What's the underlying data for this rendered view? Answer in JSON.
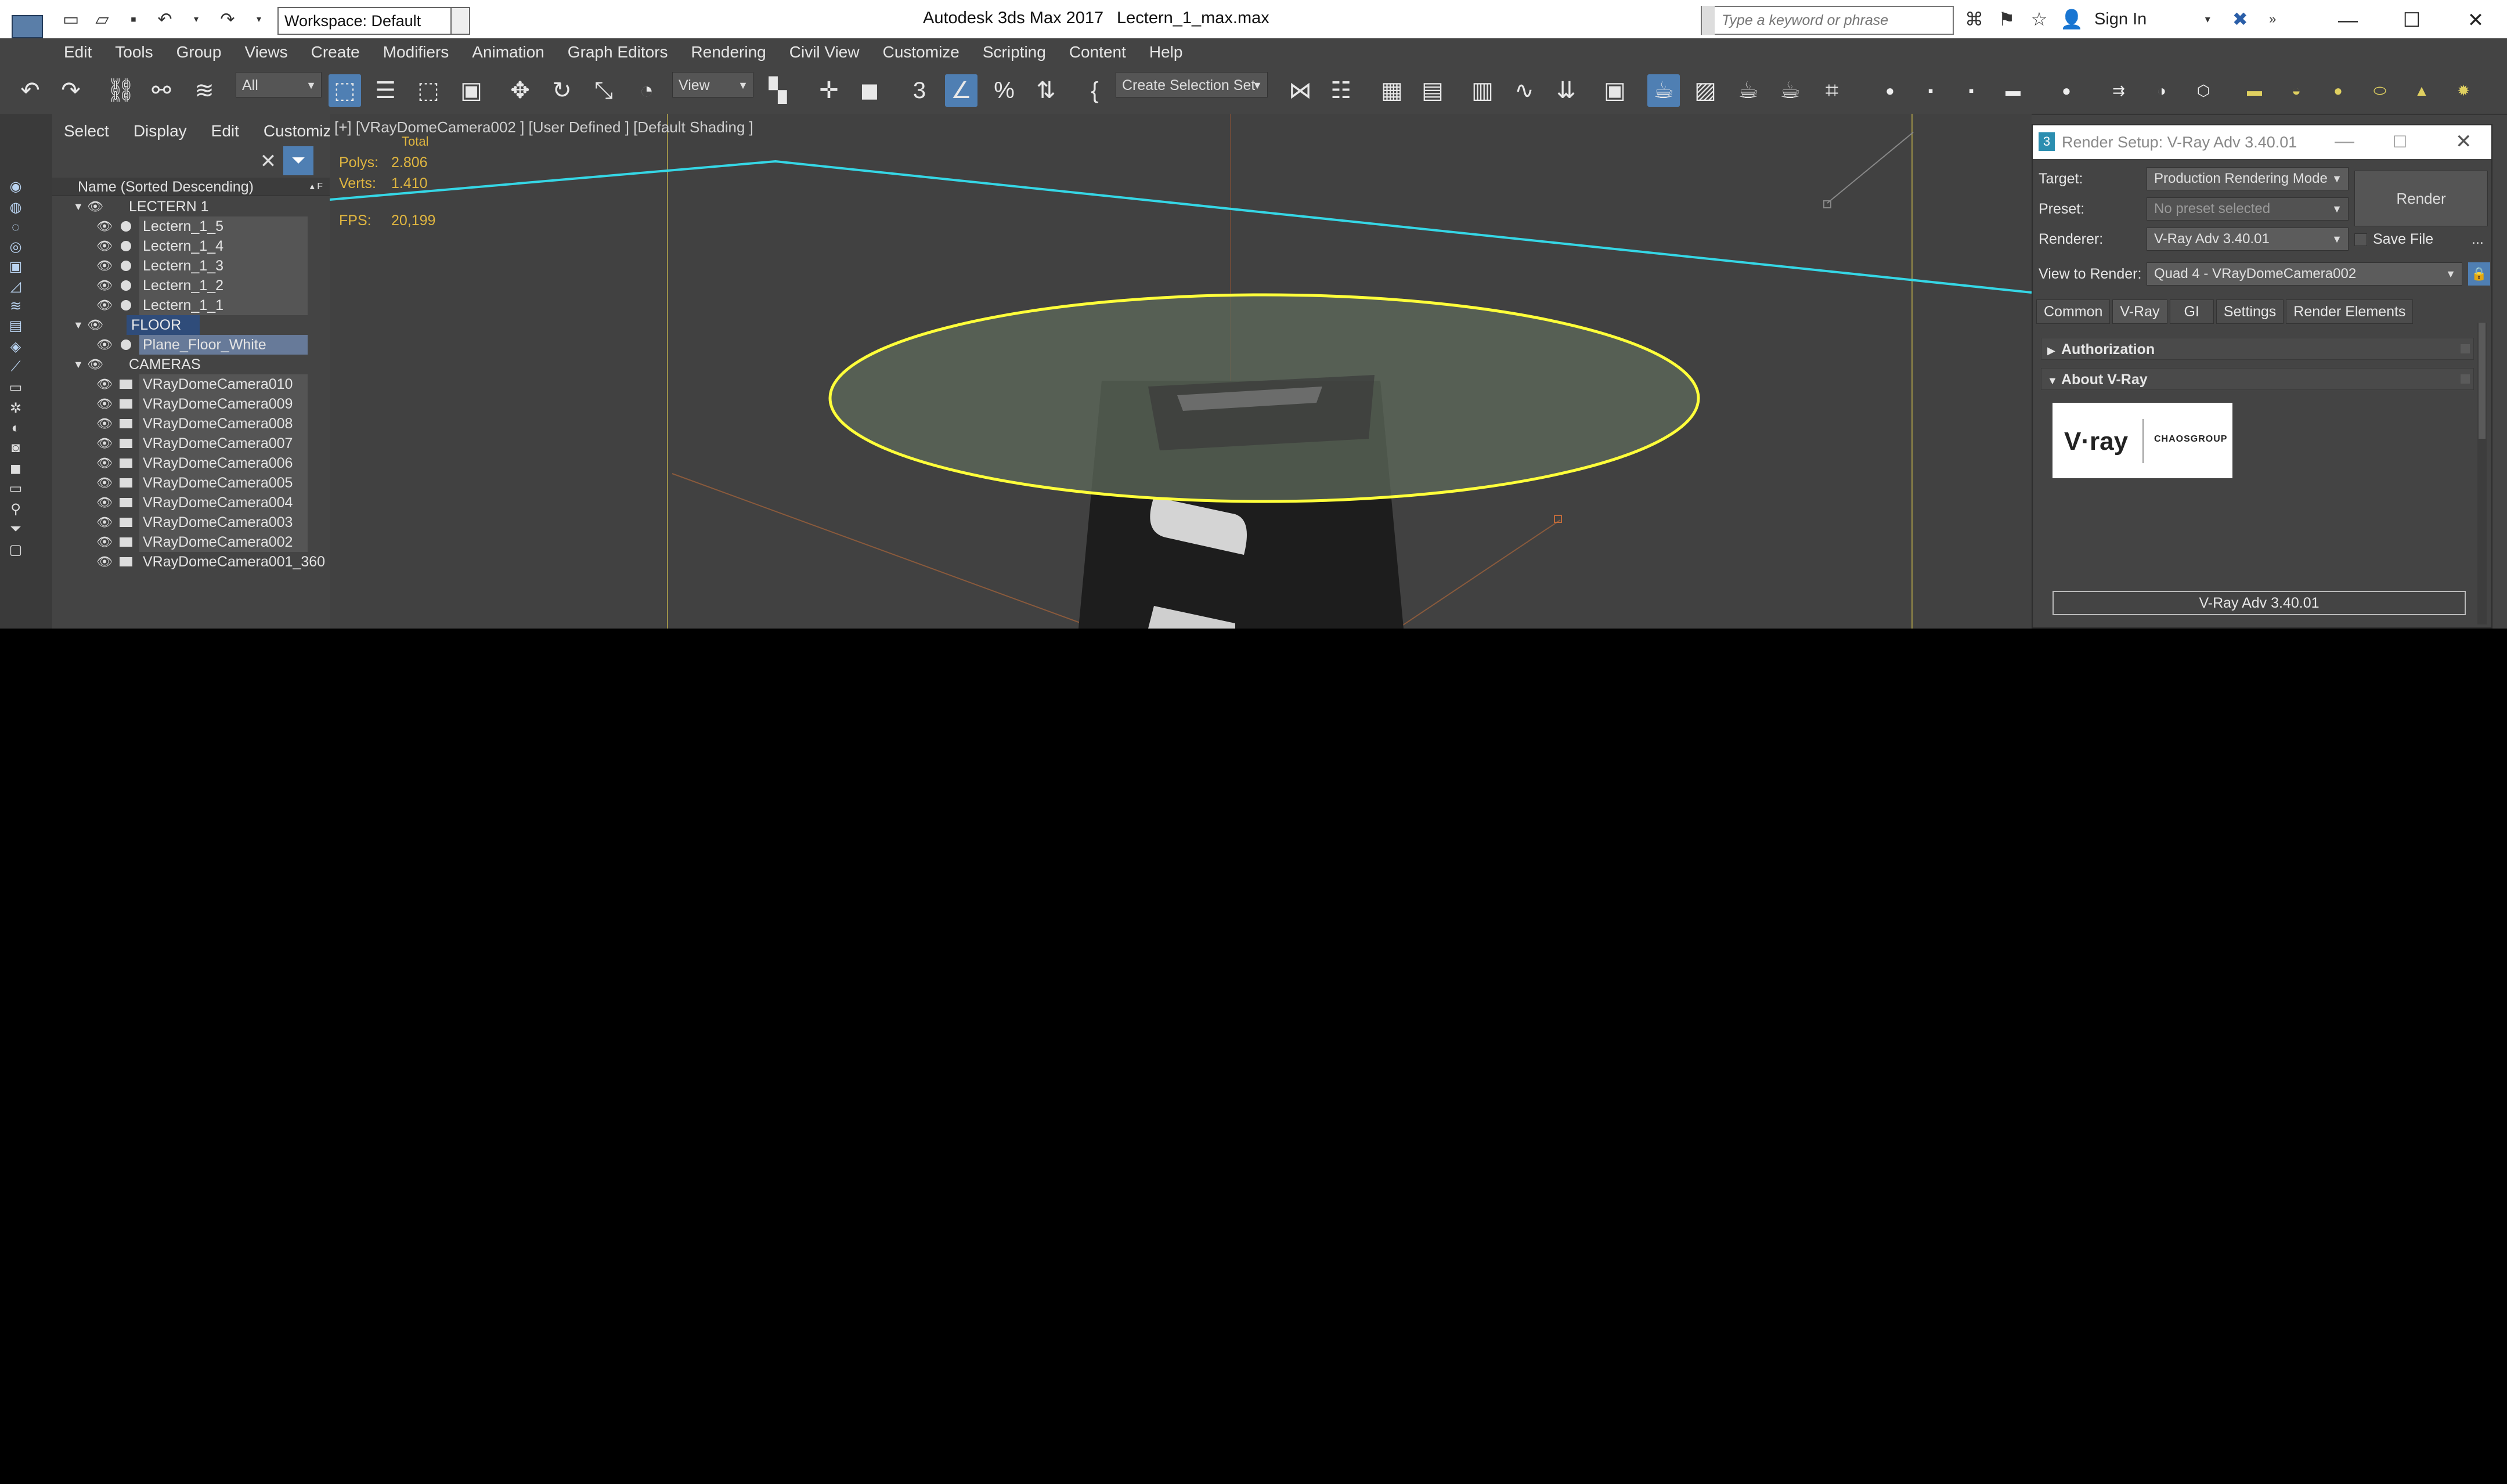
{
  "window": {
    "app_title": "Autodesk 3ds Max 2017",
    "file_name": "Lectern_1_max.max",
    "workspace_label": "Workspace: Default",
    "search_placeholder": "Type a keyword or phrase",
    "sign_in": "Sign In"
  },
  "menu": [
    "Edit",
    "Tools",
    "Group",
    "Views",
    "Create",
    "Modifiers",
    "Animation",
    "Graph Editors",
    "Rendering",
    "Civil View",
    "Customize",
    "Scripting",
    "Content",
    "Help"
  ],
  "toolbar": {
    "filter_value": "All",
    "ref_coord_value": "View",
    "selection_set_value": "Create Selection Set"
  },
  "explorer": {
    "menu": [
      "Select",
      "Display",
      "Edit",
      "Customize"
    ],
    "column_header": "Name (Sorted Descending)",
    "rows": [
      {
        "label": "LECTERN 1",
        "kind": "layer"
      },
      {
        "label": "Lectern_1_5",
        "kind": "object"
      },
      {
        "label": "Lectern_1_4",
        "kind": "object"
      },
      {
        "label": "Lectern_1_3",
        "kind": "object"
      },
      {
        "label": "Lectern_1_2",
        "kind": "object"
      },
      {
        "label": "Lectern_1_1",
        "kind": "object"
      },
      {
        "label": "FLOOR",
        "kind": "layer"
      },
      {
        "label": "Plane_Floor_White",
        "kind": "object"
      },
      {
        "label": "CAMERAS",
        "kind": "layer"
      },
      {
        "label": "VRayDomeCamera010",
        "kind": "camera"
      },
      {
        "label": "VRayDomeCamera009",
        "kind": "camera"
      },
      {
        "label": "VRayDomeCamera008",
        "kind": "camera"
      },
      {
        "label": "VRayDomeCamera007",
        "kind": "camera"
      },
      {
        "label": "VRayDomeCamera006",
        "kind": "camera"
      },
      {
        "label": "VRayDomeCamera005",
        "kind": "camera"
      },
      {
        "label": "VRayDomeCamera004",
        "kind": "camera"
      },
      {
        "label": "VRayDomeCamera003",
        "kind": "camera"
      },
      {
        "label": "VRayDomeCamera002",
        "kind": "camera"
      },
      {
        "label": "VRayDomeCamera001_360",
        "kind": "camera"
      }
    ]
  },
  "viewport": {
    "label": "[+] [VRayDomeCamera002 ] [User Defined ] [Default Shading ]",
    "total_label": "Total",
    "polys_label": "Polys:",
    "polys_value": "2.806",
    "verts_label": "Verts:",
    "verts_value": "1.410",
    "fps_label": "FPS:",
    "fps_value": "20,199",
    "selection_color": "#ffff3a",
    "line_color": "#35d7e6"
  },
  "render_setup": {
    "title": "Render Setup: V-Ray Adv 3.40.01",
    "target_label": "Target:",
    "target_value": "Production Rendering Mode",
    "preset_label": "Preset:",
    "preset_value": "No preset selected",
    "renderer_label": "Renderer:",
    "renderer_value": "V-Ray Adv 3.40.01",
    "save_file_label": "Save File",
    "more_label": "...",
    "view_label": "View to Render:",
    "view_value": "Quad 4 - VRayDomeCamera002",
    "render_button": "Render",
    "tabs": [
      "Common",
      "V-Ray",
      "GI",
      "Settings",
      "Render Elements"
    ],
    "rollout_authorization": "Authorization",
    "rollout_about": "About V-Ray",
    "logo_text": "V·ray",
    "logo_maker": "CHAOSGROUP",
    "version_label": "V-Ray Adv 3.40.01",
    "accent_color": "#4f7fb3"
  }
}
